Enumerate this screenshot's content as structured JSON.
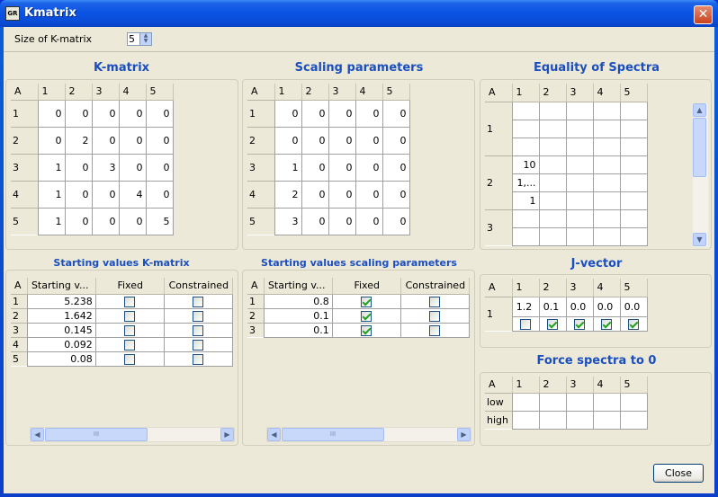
{
  "window": {
    "title": "Kmatrix",
    "icon": "app-icon",
    "icon_text": "GR"
  },
  "size": {
    "label": "Size of K-matrix",
    "value": "5"
  },
  "kmatrix": {
    "title": "K-matrix",
    "corner": "A",
    "cols": [
      "1",
      "2",
      "3",
      "4",
      "5"
    ],
    "rows": [
      {
        "label": "1",
        "cells": [
          "0",
          "0",
          "0",
          "0",
          "0"
        ]
      },
      {
        "label": "2",
        "cells": [
          "0",
          "2",
          "0",
          "0",
          "0"
        ]
      },
      {
        "label": "3",
        "cells": [
          "1",
          "0",
          "3",
          "0",
          "0"
        ]
      },
      {
        "label": "4",
        "cells": [
          "1",
          "0",
          "0",
          "4",
          "0"
        ]
      },
      {
        "label": "5",
        "cells": [
          "1",
          "0",
          "0",
          "0",
          "5"
        ]
      }
    ]
  },
  "scaling": {
    "title": "Scaling parameters",
    "corner": "A",
    "cols": [
      "1",
      "2",
      "3",
      "4",
      "5"
    ],
    "rows": [
      {
        "label": "1",
        "cells": [
          "0",
          "0",
          "0",
          "0",
          "0"
        ]
      },
      {
        "label": "2",
        "cells": [
          "0",
          "0",
          "0",
          "0",
          "0"
        ]
      },
      {
        "label": "3",
        "cells": [
          "1",
          "0",
          "0",
          "0",
          "0"
        ]
      },
      {
        "label": "4",
        "cells": [
          "2",
          "0",
          "0",
          "0",
          "0"
        ]
      },
      {
        "label": "5",
        "cells": [
          "3",
          "0",
          "0",
          "0",
          "0"
        ]
      }
    ]
  },
  "equality": {
    "title": "Equality of Spectra",
    "corner": "A",
    "cols": [
      "1",
      "2",
      "3",
      "4",
      "5"
    ],
    "groups": [
      "1",
      "2",
      "3"
    ],
    "rows": [
      [
        "",
        "",
        "",
        "",
        ""
      ],
      [
        "",
        "",
        "",
        "",
        ""
      ],
      [
        "",
        "",
        "",
        "",
        ""
      ],
      [
        "10",
        "",
        "",
        "",
        ""
      ],
      [
        "1,...",
        "",
        "",
        "",
        ""
      ],
      [
        "1",
        "",
        "",
        "",
        ""
      ],
      [
        "",
        "",
        "",
        "",
        ""
      ],
      [
        "",
        "",
        "",
        "",
        ""
      ]
    ]
  },
  "start_k": {
    "title": "Starting values K-matrix",
    "headers": [
      "A",
      "Starting v...",
      "Fixed",
      "Constrained"
    ],
    "rows": [
      {
        "label": "1",
        "value": "5.238",
        "fixed": false,
        "constrained": false
      },
      {
        "label": "2",
        "value": "1.642",
        "fixed": false,
        "constrained": false
      },
      {
        "label": "3",
        "value": "0.145",
        "fixed": false,
        "constrained": false
      },
      {
        "label": "4",
        "value": "0.092",
        "fixed": false,
        "constrained": false
      },
      {
        "label": "5",
        "value": "0.08",
        "fixed": false,
        "constrained": false
      }
    ]
  },
  "start_s": {
    "title": "Starting values scaling parameters",
    "headers": [
      "A",
      "Starting v...",
      "Fixed",
      "Constrained"
    ],
    "rows": [
      {
        "label": "1",
        "value": "0.8",
        "fixed": true,
        "constrained": false
      },
      {
        "label": "2",
        "value": "0.1",
        "fixed": true,
        "constrained": false
      },
      {
        "label": "3",
        "value": "0.1",
        "fixed": true,
        "constrained": false
      }
    ]
  },
  "jvector": {
    "title": "J-vector",
    "corner": "A",
    "cols": [
      "1",
      "2",
      "3",
      "4",
      "5"
    ],
    "row_label": "1",
    "values": [
      "1.2",
      "0.1",
      "0.0",
      "0.0",
      "0.0"
    ],
    "checks": [
      false,
      true,
      true,
      true,
      true
    ]
  },
  "force": {
    "title": "Force spectra to 0",
    "corner": "A",
    "cols": [
      "1",
      "2",
      "3",
      "4",
      "5"
    ],
    "rows": [
      {
        "label": "low",
        "cells": [
          "",
          "",
          "",
          "",
          ""
        ]
      },
      {
        "label": "high",
        "cells": [
          "",
          "",
          "",
          "",
          ""
        ]
      }
    ]
  },
  "scroll": {
    "grip": "III",
    "left": "left-arrow-icon",
    "right": "right-arrow-icon",
    "up": "up-arrow-icon",
    "down": "down-arrow-icon"
  },
  "close_label": "Close",
  "colors": {
    "title_blue": "#1b4fbf",
    "window_bg": "#ece9d8",
    "titlebar": "#0b54e3"
  }
}
